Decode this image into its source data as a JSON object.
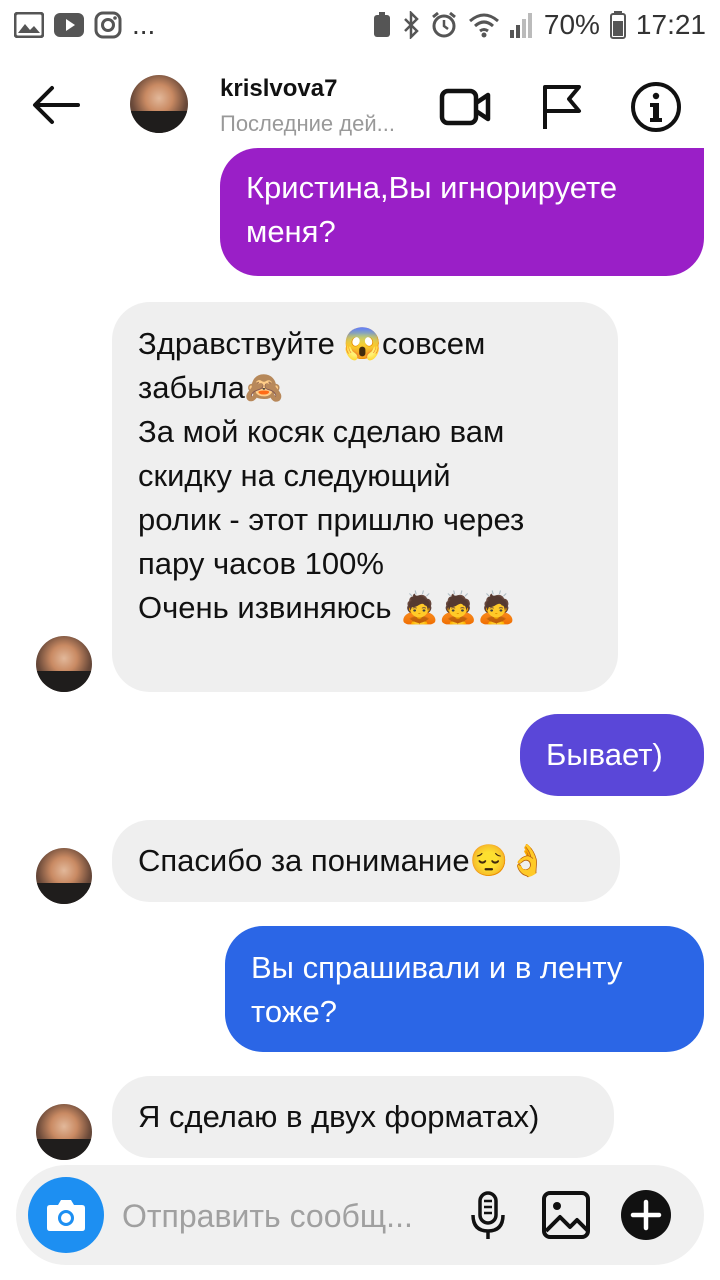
{
  "status_bar": {
    "battery": "70%",
    "time": "17:21",
    "more": "..."
  },
  "header": {
    "username": "krislvova7",
    "status": "Последние дей..."
  },
  "messages": [
    {
      "side": "sent",
      "text": "Кристина,Вы игнорируете меня?"
    },
    {
      "side": "received",
      "lines": [
        "Здравствуйте 😱совсем",
        "забыла🙈",
        "За мой косяк сделаю вам",
        "скидку на следующий",
        "ролик - этот пришлю через",
        "пару часов 100%",
        "",
        "Очень извиняюсь 🙇🙇🙇"
      ]
    },
    {
      "side": "sent",
      "text": "Бывает)"
    },
    {
      "side": "received",
      "text": "Спасибо за понимание😔👌"
    },
    {
      "side": "sent",
      "text": "Вы спрашивали и в ленту тоже?"
    },
    {
      "side": "received",
      "text": "Я сделаю в двух форматах)"
    }
  ],
  "composer": {
    "placeholder": "Отправить сообщ..."
  },
  "colors": {
    "bubble_purple": "#9a1fc7",
    "bubble_indigo": "#5a47d8",
    "bubble_blue": "#2b66e6",
    "bubble_received": "#efefef",
    "camera_button": "#1d8ff2"
  }
}
